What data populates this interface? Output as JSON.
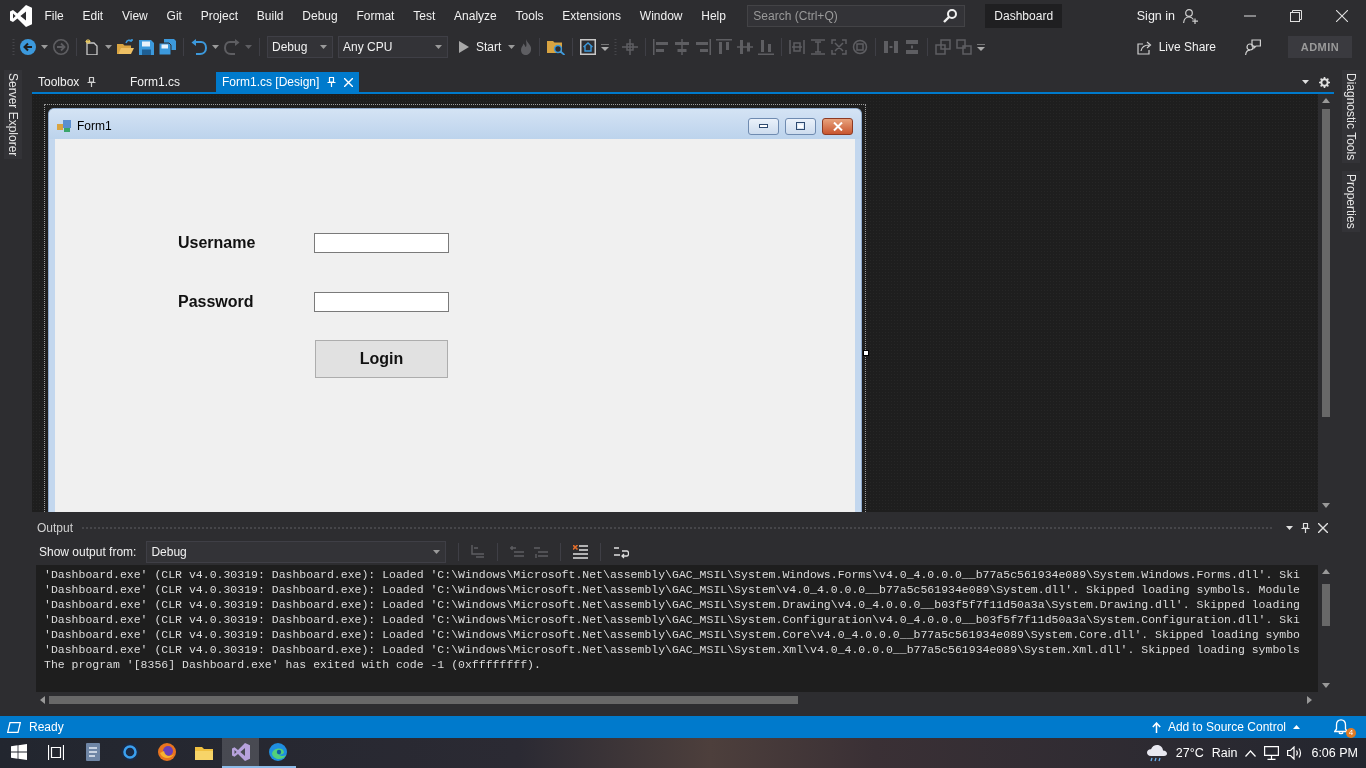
{
  "title_bar": {
    "menu": [
      "File",
      "Edit",
      "View",
      "Git",
      "Project",
      "Build",
      "Debug",
      "Format",
      "Test",
      "Analyze",
      "Tools",
      "Extensions",
      "Window",
      "Help"
    ],
    "search": {
      "placeholder": "Search (Ctrl+Q)"
    },
    "solution": "Dashboard",
    "sign_in": "Sign in"
  },
  "toolbar": {
    "configuration": "Debug",
    "platform": "Any CPU",
    "start": "Start",
    "live_share": "Live Share",
    "account_badge": "ADMIN"
  },
  "side_panels": {
    "left": [
      "Server Explorer"
    ],
    "right": [
      "Diagnostic Tools",
      "Properties"
    ]
  },
  "document_tabs": [
    {
      "label": "Toolbox",
      "selected": false,
      "pin": true
    },
    {
      "label": "Form1.cs",
      "selected": false,
      "pin": false
    },
    {
      "label": "Form1.cs [Design]",
      "selected": true,
      "pin": true
    }
  ],
  "designer": {
    "form": {
      "title": "Form1",
      "fields": [
        {
          "label": "Username"
        },
        {
          "label": "Password"
        }
      ],
      "button": "Login"
    }
  },
  "output": {
    "title": "Output",
    "source_label": "Show output from:",
    "source": "Debug",
    "lines": [
      "'Dashboard.exe' (CLR v4.0.30319: Dashboard.exe): Loaded 'C:\\Windows\\Microsoft.Net\\assembly\\GAC_MSIL\\System.Windows.Forms\\v4.0_4.0.0.0__b77a5c561934e089\\System.Windows.Forms.dll'. Ski",
      "'Dashboard.exe' (CLR v4.0.30319: Dashboard.exe): Loaded 'C:\\Windows\\Microsoft.Net\\assembly\\GAC_MSIL\\System\\v4.0_4.0.0.0__b77a5c561934e089\\System.dll'. Skipped loading symbols. Module",
      "'Dashboard.exe' (CLR v4.0.30319: Dashboard.exe): Loaded 'C:\\Windows\\Microsoft.Net\\assembly\\GAC_MSIL\\System.Drawing\\v4.0_4.0.0.0__b03f5f7f11d50a3a\\System.Drawing.dll'. Skipped loading",
      "'Dashboard.exe' (CLR v4.0.30319: Dashboard.exe): Loaded 'C:\\Windows\\Microsoft.Net\\assembly\\GAC_MSIL\\System.Configuration\\v4.0_4.0.0.0__b03f5f7f11d50a3a\\System.Configuration.dll'. Ski",
      "'Dashboard.exe' (CLR v4.0.30319: Dashboard.exe): Loaded 'C:\\Windows\\Microsoft.Net\\assembly\\GAC_MSIL\\System.Core\\v4.0_4.0.0.0__b77a5c561934e089\\System.Core.dll'. Skipped loading symbo",
      "'Dashboard.exe' (CLR v4.0.30319: Dashboard.exe): Loaded 'C:\\Windows\\Microsoft.Net\\assembly\\GAC_MSIL\\System.Xml\\v4.0_4.0.0.0__b77a5c561934e089\\System.Xml.dll'. Skipped loading symbols",
      "The program '[8356] Dashboard.exe' has exited with code -1 (0xffffffff)."
    ]
  },
  "status_bar": {
    "state": "Ready",
    "source_control": "Add to Source Control",
    "notifications": "4"
  },
  "taskbar": {
    "apps": [
      {
        "kind": "notebook",
        "running": false,
        "selected": false
      },
      {
        "kind": "ring",
        "running": false,
        "selected": false
      },
      {
        "kind": "globe",
        "running": false,
        "selected": false
      },
      {
        "kind": "folder",
        "running": false,
        "selected": false
      },
      {
        "kind": "ribbon",
        "running": true,
        "selected": true
      },
      {
        "kind": "swirl",
        "running": true,
        "selected": false
      }
    ],
    "weather": {
      "temperature": "27°C",
      "condition": "Rain"
    },
    "clock": "6:06 PM"
  }
}
